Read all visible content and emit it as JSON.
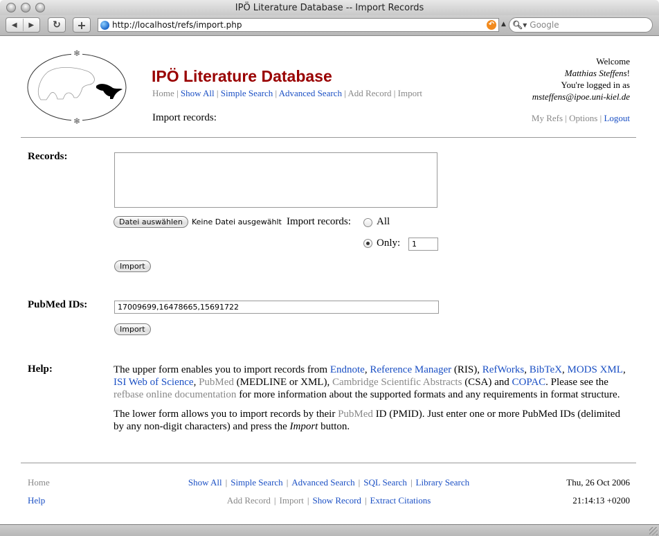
{
  "browser": {
    "window_title": "IPÖ Literature Database -- Import Records",
    "url": "http://localhost/refs/import.php",
    "search_placeholder": "Google"
  },
  "site": {
    "title": "IPÖ Literature Database",
    "page_heading": "Import records:"
  },
  "topnav": [
    {
      "label": "Home",
      "active": false
    },
    {
      "label": "Show All",
      "active": true
    },
    {
      "label": "Simple Search",
      "active": true
    },
    {
      "label": "Advanced Search",
      "active": true
    },
    {
      "label": "Add Record",
      "active": false
    },
    {
      "label": "Import",
      "active": false
    }
  ],
  "user": {
    "welcome": "Welcome",
    "name": "Matthias Steffens",
    "logged_in_as": "You're logged in as",
    "email": "msteffens@ipoe.uni-kiel.de",
    "links": [
      {
        "label": "My Refs"
      },
      {
        "label": "Options"
      },
      {
        "label": "Logout"
      }
    ]
  },
  "records_form": {
    "label": "Records:",
    "textarea_value": "",
    "file_button": "Datei auswählen",
    "file_status": "Keine Datei ausgewählt",
    "import_records_label": "Import records:",
    "option_all": "All",
    "option_only": "Only:",
    "selected_option": "only",
    "only_count": "1",
    "submit": "Import"
  },
  "pubmed_form": {
    "label": "PubMed IDs:",
    "value": "17009699,16478665,15691722",
    "submit": "Import"
  },
  "help": {
    "label": "Help:",
    "p1": {
      "t0": "The upper form enables you to import records from ",
      "endnote": "Endnote",
      "t1": ", ",
      "refman": "Reference Manager",
      "t2": " (RIS), ",
      "refworks": "RefWorks",
      "t3": ", ",
      "bibtex": "BibTeX",
      "t4": ", ",
      "mods": "MODS XML",
      "t5": ", ",
      "isi": "ISI Web of Science",
      "t6": ", ",
      "pubmed": "PubMed",
      "t7": " (MEDLINE or XML), ",
      "csa": "Cambridge Scientific Abstracts",
      "t8": " (CSA) and ",
      "copac": "COPAC",
      "t9": ". Please see the ",
      "docs": "refbase online documentation",
      "t10": " for more information about the supported formats and any requirements in format structure."
    },
    "p2": {
      "t0": "The lower form allows you to import records by their ",
      "pubmed": "PubMed",
      "t1": " ID (PMID). Just enter one or more PubMed IDs (delimited by any non-digit characters) and press the ",
      "import_em": "Import",
      "t2": " button."
    }
  },
  "footer": {
    "row1": {
      "left": "Home",
      "links": [
        "Show All",
        "Simple Search",
        "Advanced Search",
        "SQL Search",
        "Library Search"
      ],
      "right": "Thu, 26 Oct 2006"
    },
    "row2": {
      "left": "Help",
      "links": [
        "Add Record",
        "Import",
        "Show Record",
        "Extract Citations"
      ],
      "right": "21:14:13 +0200"
    }
  },
  "colors": {
    "title": "#990000",
    "link": "#1a4fc4",
    "inactive_link": "#888888"
  }
}
